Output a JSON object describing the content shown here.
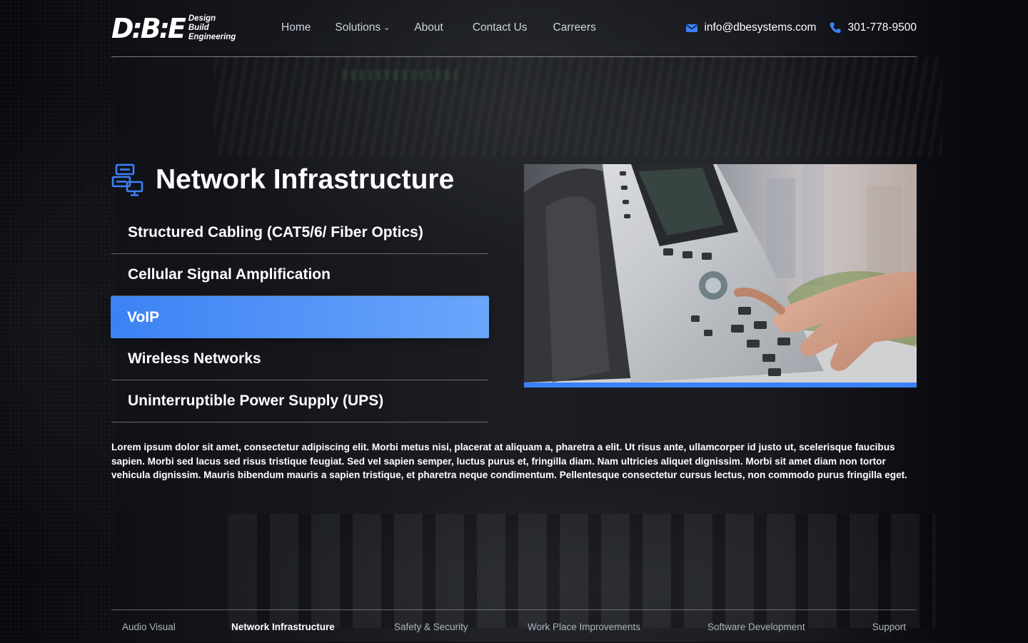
{
  "brand": {
    "mark": "D:B:E",
    "words": [
      "Design",
      "Build",
      "Engineering"
    ]
  },
  "nav": {
    "items": [
      {
        "label": "Home"
      },
      {
        "label": "Solutions",
        "has_dropdown": true
      },
      {
        "label": "About"
      },
      {
        "label": "Contact Us"
      },
      {
        "label": "Carreers"
      }
    ]
  },
  "contact": {
    "email": "info@dbesystems.com",
    "phone": "301-778-9500",
    "email_icon": "envelope-icon",
    "phone_icon": "phone-icon"
  },
  "section": {
    "title": "Network Infrastructure",
    "icon": "network-computers-icon",
    "items": [
      {
        "label": "Structured Cabling (CAT5/6/ Fiber Optics)",
        "active": false
      },
      {
        "label": "Cellular Signal Amplification",
        "active": false
      },
      {
        "label": "VoIP",
        "active": true
      },
      {
        "label": "Wireless Networks",
        "active": false
      },
      {
        "label": "Uninterruptible Power Supply (UPS)",
        "active": false
      }
    ],
    "image": "office desk phone keypad photo",
    "description": "Lorem ipsum dolor sit amet, consectetur adipiscing elit. Morbi metus nisi, placerat at aliquam a, pharetra a elit. Ut risus ante, ullamcorper id justo ut, scelerisque faucibus sapien. Morbi sed lacus sed risus tristique feugiat. Sed vel sapien semper, luctus purus et, fringilla diam. Nam ultricies aliquet dignissim. Morbi sit amet diam non tortor vehicula dignissim. Mauris bibendum mauris a sapien tristique, et pharetra neque condimentum. Pellentesque consectetur cursus lectus, non commodo purus fringilla eget."
  },
  "footer_tabs": [
    {
      "label": "Audio Visual",
      "active": false
    },
    {
      "label": "Network Infrastructure",
      "active": true
    },
    {
      "label": "Safety & Security",
      "active": false
    },
    {
      "label": "Work Place Improvements",
      "active": false
    },
    {
      "label": "Software Development",
      "active": false
    },
    {
      "label": "Support",
      "active": false
    }
  ],
  "colors": {
    "accent": "#3b82f6",
    "accent_light": "#6aa6fb",
    "text": "#ffffff",
    "nav_text": "#cfd3da",
    "background": "#0b0d12"
  }
}
